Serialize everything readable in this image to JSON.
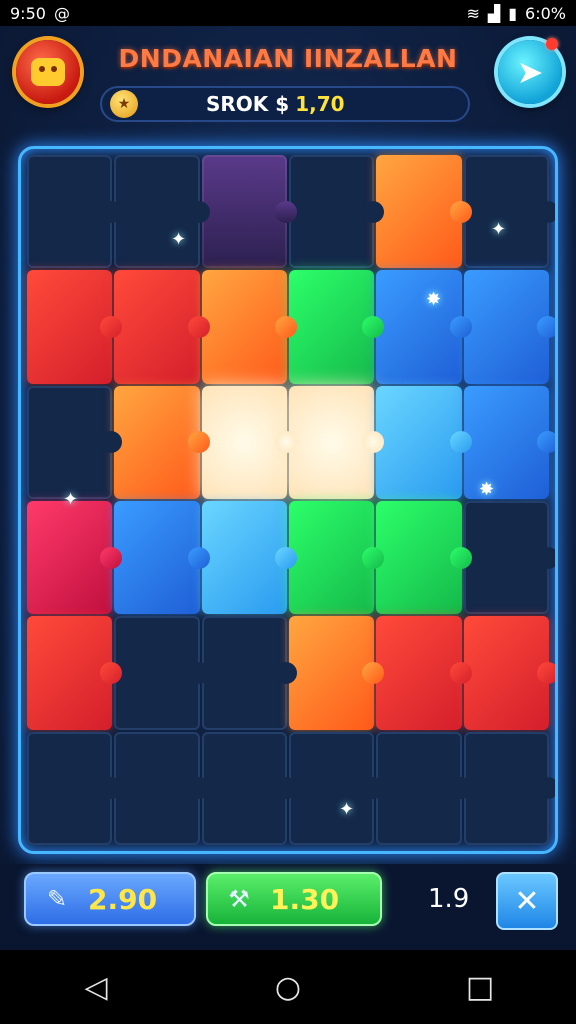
{
  "status_bar": {
    "time": "9:50",
    "battery": "6:0%",
    "icons": [
      "at-icon",
      "wifi-icon",
      "signal-icon",
      "battery-icon"
    ]
  },
  "header": {
    "title": "DNDANAIAN IINZALLAN",
    "score_label": "SROK $",
    "score_value": "1,70",
    "menu_icon": "monster-face-icon",
    "next_icon": "arrow-right-icon"
  },
  "board": {
    "rows": [
      [
        "empty",
        "empty",
        "purple",
        "empty",
        "orange",
        "empty"
      ],
      [
        "red",
        "red",
        "orange",
        "green",
        "blue",
        "blue"
      ],
      [
        "empty",
        "orange",
        "white",
        "white",
        "lightblue",
        "blue"
      ],
      [
        "magenta",
        "blue",
        "lightblue",
        "green",
        "green",
        "empty"
      ],
      [
        "red",
        "empty",
        "empty",
        "orange",
        "red",
        "red"
      ],
      [
        "empty",
        "empty",
        "empty",
        "empty",
        "empty",
        "empty"
      ]
    ]
  },
  "bottom": {
    "hint_value": "2.90",
    "magnet_value": "1.30",
    "moves": "1.9",
    "close_icon": "close-icon"
  },
  "colors": {
    "accent": "#47b7ff",
    "title": "#ff7a45",
    "coin": "#ffe23a"
  }
}
